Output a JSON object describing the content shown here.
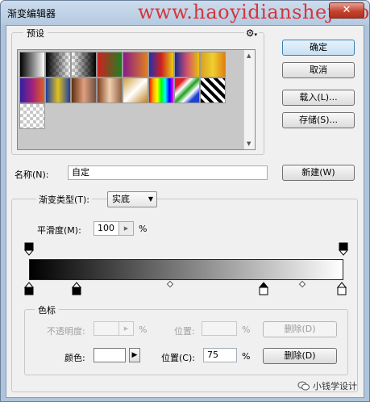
{
  "window": {
    "title": "渐变编辑器",
    "watermark": "www.haoyidianshejì.com",
    "close_symbol": "✕"
  },
  "presets": {
    "label": "预设",
    "settings_icon": "gear-icon",
    "scroll_up": "▲",
    "scroll_down": "▼",
    "swatches": [
      "linear-gradient(90deg,#000,#fff)",
      "checker-black",
      "checker-black-r",
      "linear-gradient(90deg,#d02020,#208020)",
      "linear-gradient(90deg,#8a1a8a,#e08020)",
      "linear-gradient(90deg,#2030b0,#d02020,#e8d010)",
      "linear-gradient(90deg,#1a2a90,#d05070,#e8c010)",
      "linear-gradient(90deg,#d8a020,#f0d030,#e08010)",
      "linear-gradient(90deg,#3020a0,#a02080,#e06020)",
      "linear-gradient(90deg,#1c3fa0,#e0c020,#1c3fa0)",
      "linear-gradient(90deg,#603010,#e0a080,#705040)",
      "linear-gradient(90deg,#804020,#f0d0b0,#906040)",
      "linear-gradient(135deg,#d0a040,#fff,#c08020)",
      "linear-gradient(90deg,red,orange,yellow,lime,cyan,blue,magenta)",
      "linear-gradient(135deg,#e02020 20%,#fff 35%,#20a020 50%,#fff 65%,#2040d0 80%)",
      "stripes",
      "checker"
    ]
  },
  "buttons": {
    "ok": "确定",
    "cancel": "取消",
    "load": "载入(L)...",
    "save": "存储(S)...",
    "new": "新建(W)",
    "delete_opacity": "删除(D)",
    "delete_color": "删除(D)"
  },
  "name": {
    "label": "名称(N):",
    "value": "自定"
  },
  "gradient": {
    "type_label": "渐变类型(T):",
    "type_value": "实底",
    "smoothness_label": "平滑度(M):",
    "smoothness_value": "100",
    "percent": "%",
    "colors": [
      "#000000",
      "#ffffff"
    ]
  },
  "stops": {
    "group_label": "色标",
    "opacity_label": "不透明度:",
    "opacity_value": "",
    "opacity_unit": "%",
    "opacity_location_label": "位置:",
    "opacity_location_value": "",
    "opacity_location_unit": "%",
    "color_label": "颜色:",
    "color_value": "#ffffff",
    "color_arrow": "▶",
    "location_label": "位置(C):",
    "location_value": "75",
    "location_unit": "%"
  },
  "footer": {
    "wechat_text": "小钱学设计"
  }
}
